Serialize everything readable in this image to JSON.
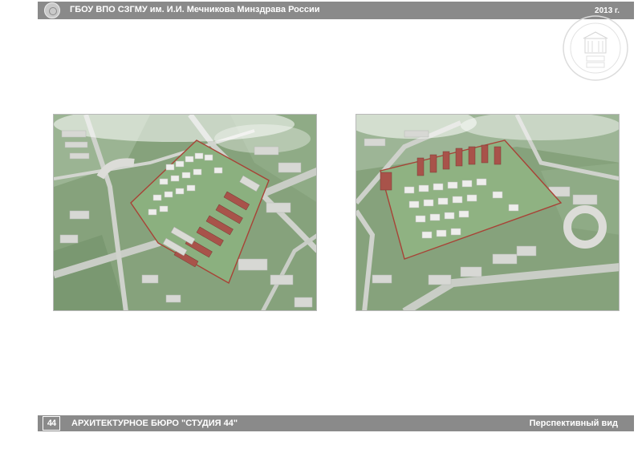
{
  "header": {
    "title": "ГБОУ ВПО СЗГМУ им. И.И. Мечникова Минздрава России",
    "year": "2013 г."
  },
  "footer": {
    "logo_text": "44",
    "studio": "АРХИТЕКТУРНОЕ БЮРО \"СТУДИЯ 44\"",
    "view_label": "Перспективный вид"
  },
  "icons": {
    "header_logo": "university-emblem-icon",
    "seal": "stamp-seal-icon",
    "footer_logo": "studio-44-logo-icon"
  },
  "colors": {
    "bar": "#8a8a8a",
    "grass": "#7f9f76",
    "boundary": "#a84236",
    "roofs_red": "#a8534a"
  }
}
